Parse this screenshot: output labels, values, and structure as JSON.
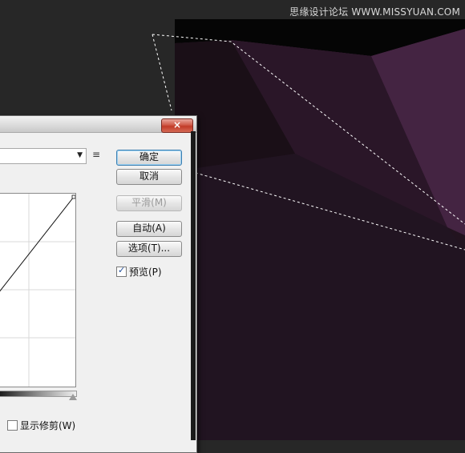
{
  "watermark": "思缘设计论坛 WWW.MISSYUAN.COM",
  "dialog": {
    "close_glyph": "×",
    "buttons": {
      "ok": "确定",
      "cancel": "取消",
      "smooth": "平滑(M)",
      "auto": "自动(A)",
      "options": "选项(T)..."
    },
    "preview": {
      "label": "预览(P)",
      "checked": true
    },
    "show_clipping": {
      "label": "显示修剪(W)",
      "checked": false
    },
    "preset_arrow": "▼",
    "preset_menu_icon": "≡"
  },
  "colors": {
    "canvas_dark": "#1d1119",
    "canvas_purple": "#3e1f3b",
    "selection": "#ffffff",
    "close_red": "#c23b28"
  }
}
